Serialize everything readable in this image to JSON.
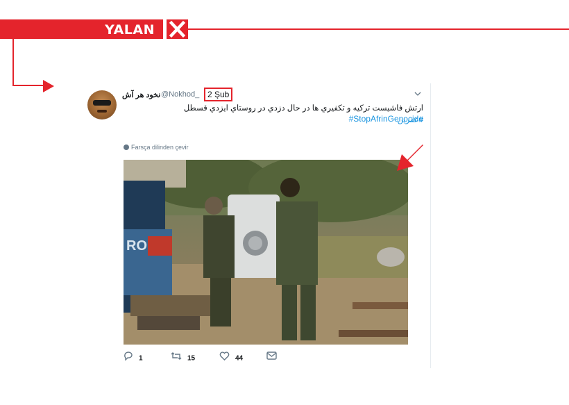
{
  "verdict": {
    "label": "YALAN",
    "color": "#e4242c"
  },
  "tweet": {
    "display_name": "نخود هر آش",
    "handle": "@Nokhod_",
    "date": "2 Şub",
    "text_main": "ارتش فاشيست تركيه و تكفيري ها در حال دزدي در روستاي ايزدي قسطل",
    "hashtag_inline": "#عفرين",
    "hashtag_line": "#StopAfrinGenocide",
    "translate_label": "Farsça dilinden çevir",
    "replies": "1",
    "retweets": "15",
    "likes": "44",
    "icons": {
      "reply": "reply-icon",
      "retweet": "retweet-icon",
      "like": "heart-icon",
      "dm": "message-icon"
    }
  },
  "colors": {
    "accent_red": "#e4242c",
    "link_blue": "#1b95e0",
    "muted": "#657786"
  }
}
